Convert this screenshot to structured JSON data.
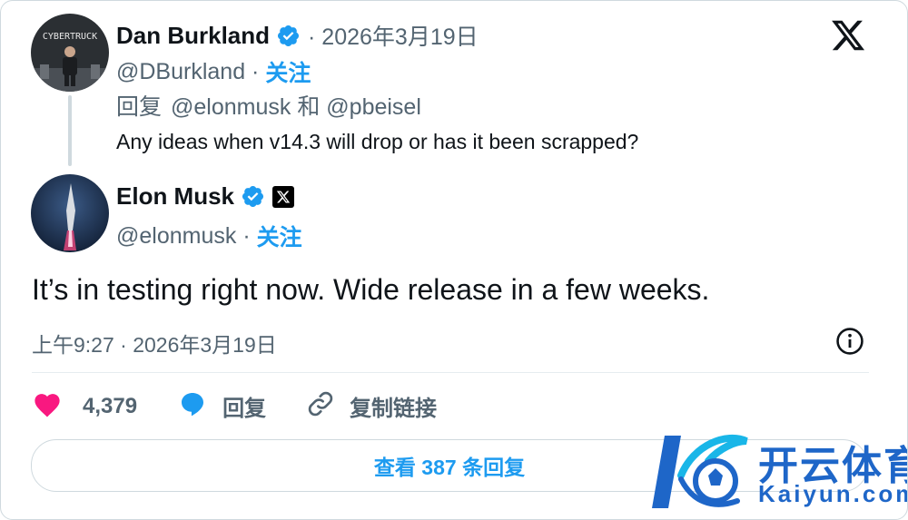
{
  "reply_tweet": {
    "author_name": "Dan Burkland",
    "date": "· 2026年3月19日",
    "handle": "@DBurkland",
    "follow_label": "关注",
    "separator": " · ",
    "reply_to_prefix": "回复",
    "reply_to_handles": "@elonmusk 和 @pbeisel",
    "text": "Any ideas when v14.3 will drop or has it been scrapped?",
    "avatar_text": "CYBERTRUCK"
  },
  "main_tweet": {
    "author_name": "Elon Musk",
    "handle": "@elonmusk",
    "follow_label": "关注",
    "separator": " · ",
    "text": "It’s in testing right now. Wide release in a few weeks.",
    "timestamp": "上午9:27 · 2026年3月19日"
  },
  "actions": {
    "likes_count": "4,379",
    "reply_label": "回复",
    "copy_link_label": "复制链接"
  },
  "replies_button_label": "查看 387 条回复",
  "watermark": {
    "cn_text": "开云体育",
    "en_text": "Kaiyun.com"
  },
  "colors": {
    "accent": "#1d9bf0",
    "like": "#f91880",
    "secondary_text": "#536471",
    "border": "#cfd9de",
    "watermark": "#1e66c8"
  }
}
